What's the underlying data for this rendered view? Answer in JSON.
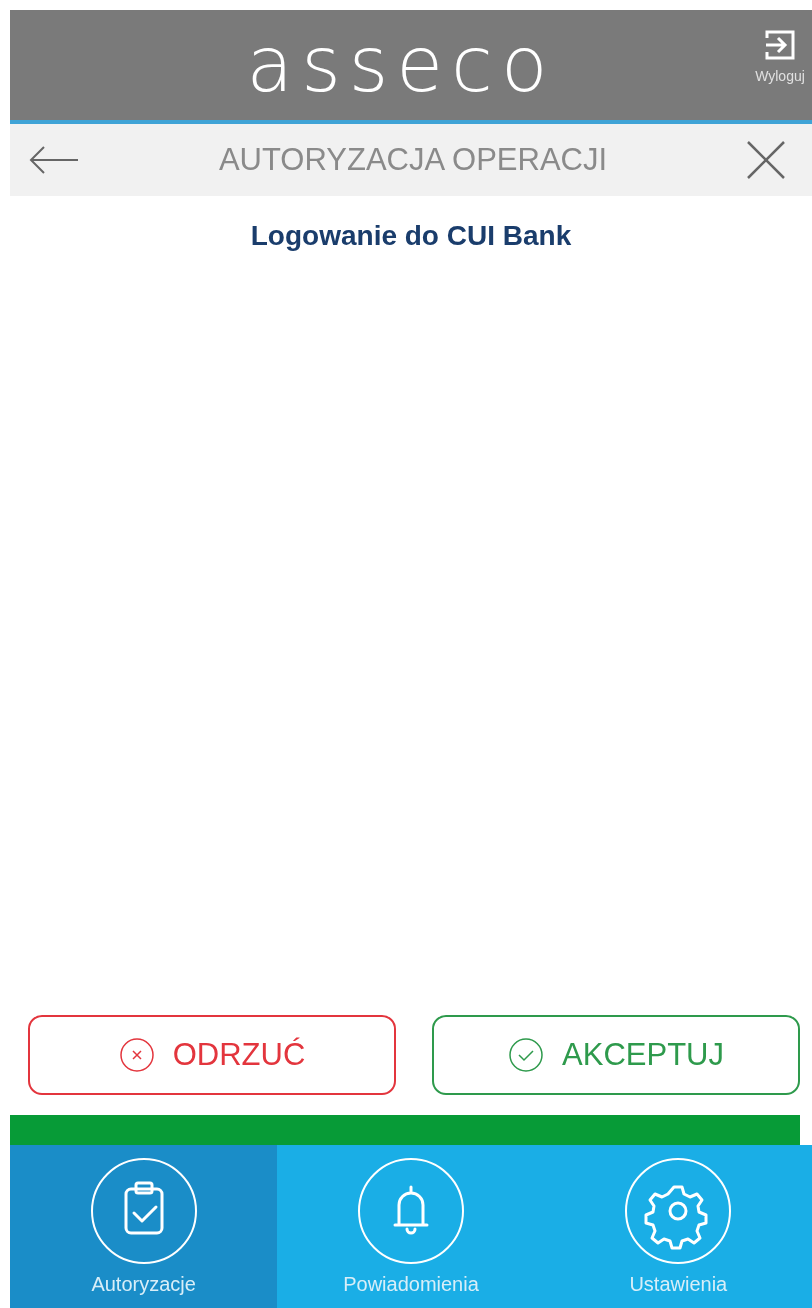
{
  "header": {
    "logo": "asseco",
    "logout_label": "Wyloguj"
  },
  "subheader": {
    "title": "AUTORYZACJA OPERACJI"
  },
  "operation": {
    "title": "Logowanie do CUI Bank"
  },
  "actions": [
    {
      "kind": "reject",
      "label": "ODRZUĆ"
    },
    {
      "kind": "accept",
      "label": "AKCEPTUJ"
    }
  ],
  "nav": [
    {
      "kind": "authorizations",
      "label": "Autoryzacje",
      "selected": true
    },
    {
      "kind": "notifications",
      "label": "Powiadomienia",
      "selected": false
    },
    {
      "kind": "settings",
      "label": "Ustawienia",
      "selected": false
    }
  ]
}
